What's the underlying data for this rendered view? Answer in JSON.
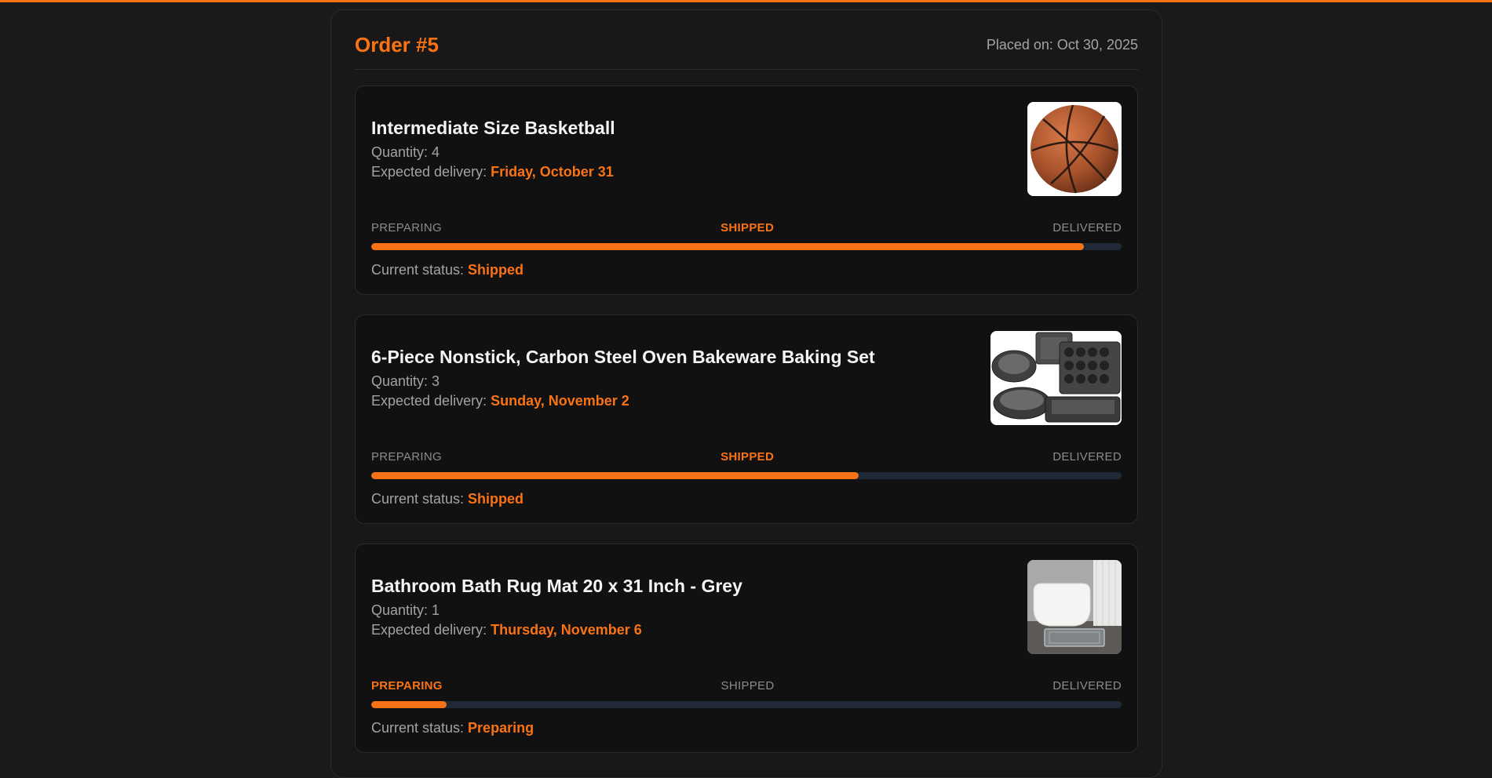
{
  "accent": "#f97316",
  "order": {
    "title": "Order #5",
    "placed_label": "Placed on: Oct 30, 2025"
  },
  "steps": [
    "PREPARING",
    "SHIPPED",
    "DELIVERED"
  ],
  "quantity_prefix": "Quantity: ",
  "delivery_prefix": "Expected delivery: ",
  "status_prefix": "Current status: ",
  "items": [
    {
      "name": "Intermediate Size Basketball",
      "quantity": "4",
      "delivery": "Friday, October 31",
      "status": "Shipped",
      "active_step": 1,
      "progress_fraction": 0.95,
      "image_icon": "basketball-image"
    },
    {
      "name": "6-Piece Nonstick, Carbon Steel Oven Bakeware Baking Set",
      "quantity": "3",
      "delivery": "Sunday, November 2",
      "status": "Shipped",
      "active_step": 1,
      "progress_fraction": 0.65,
      "image_icon": "bakeware-image"
    },
    {
      "name": "Bathroom Bath Rug Mat 20 x 31 Inch - Grey",
      "quantity": "1",
      "delivery": "Thursday, November 6",
      "status": "Preparing",
      "active_step": 0,
      "progress_fraction": 0.1,
      "image_icon": "bath-rug-image"
    }
  ]
}
